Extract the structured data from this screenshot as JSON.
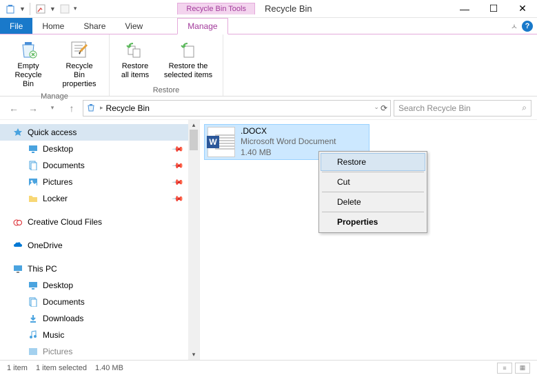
{
  "window": {
    "contextual_tab": "Recycle Bin Tools",
    "title": "Recycle Bin"
  },
  "tabs": {
    "file": "File",
    "home": "Home",
    "share": "Share",
    "view": "View",
    "manage": "Manage"
  },
  "ribbon": {
    "manage": {
      "empty": "Empty Recycle Bin",
      "properties": "Recycle Bin properties",
      "group_label": "Manage"
    },
    "restore": {
      "all": "Restore all items",
      "selected": "Restore the selected items",
      "group_label": "Restore"
    }
  },
  "nav": {
    "back": "←",
    "forward": "→",
    "up": "↑"
  },
  "breadcrumb": {
    "location": "Recycle Bin"
  },
  "search": {
    "placeholder": "Search Recycle Bin"
  },
  "tree": {
    "quick_access": "Quick access",
    "desktop": "Desktop",
    "documents": "Documents",
    "pictures": "Pictures",
    "locker": "Locker",
    "creative_cloud": "Creative Cloud Files",
    "onedrive": "OneDrive",
    "this_pc": "This PC",
    "pc_desktop": "Desktop",
    "pc_documents": "Documents",
    "pc_downloads": "Downloads",
    "pc_music": "Music",
    "pc_pictures": "Pictures"
  },
  "file": {
    "name": ".DOCX",
    "type": "Microsoft Word Document",
    "size": "1.40 MB"
  },
  "context_menu": {
    "restore": "Restore",
    "cut": "Cut",
    "delete": "Delete",
    "properties": "Properties"
  },
  "status": {
    "count": "1 item",
    "selected": "1 item selected",
    "size": "1.40 MB"
  }
}
